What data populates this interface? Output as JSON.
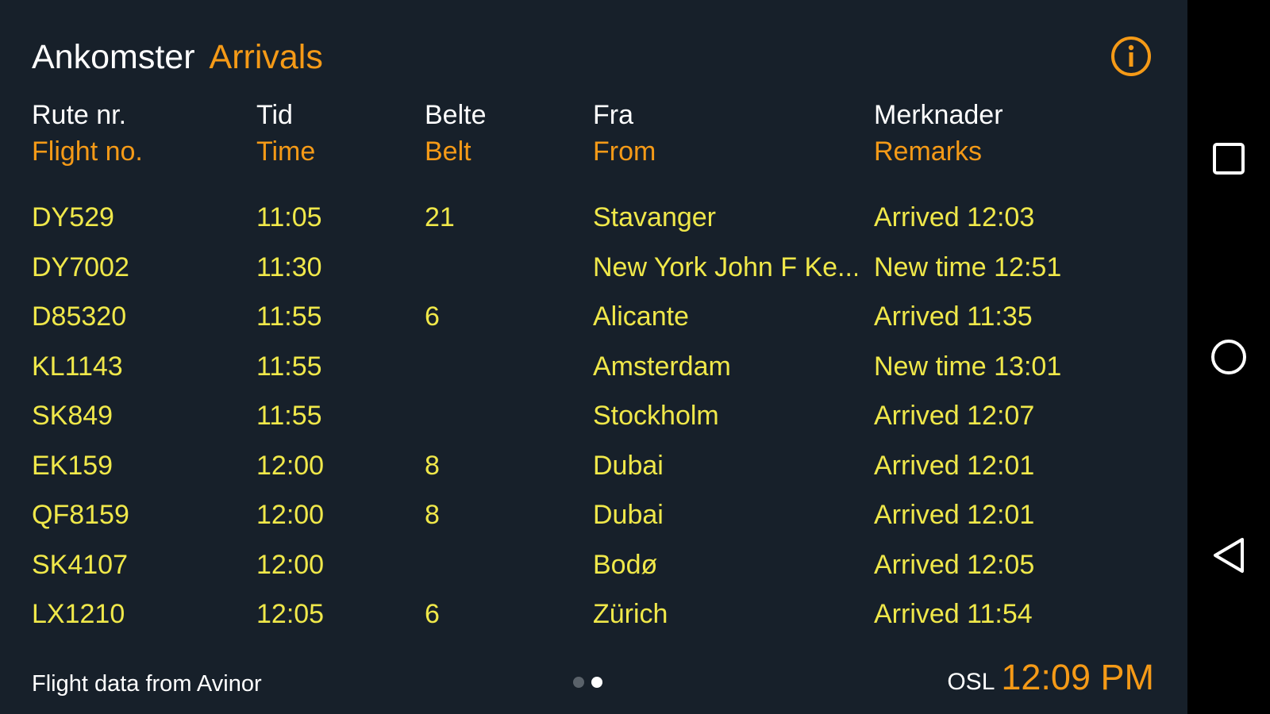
{
  "header": {
    "title_no": "Ankomster",
    "title_en": "Arrivals",
    "info_icon": "info-circle-icon"
  },
  "columns": [
    {
      "no": "Rute nr.",
      "en": "Flight no."
    },
    {
      "no": "Tid",
      "en": "Time"
    },
    {
      "no": "Belte",
      "en": "Belt"
    },
    {
      "no": "Fra",
      "en": "From"
    },
    {
      "no": "Merknader",
      "en": "Remarks"
    }
  ],
  "flights": [
    {
      "flight": "DY529",
      "time": "11:05",
      "belt": "21",
      "from": "Stavanger",
      "remarks": "Arrived 12:03"
    },
    {
      "flight": "DY7002",
      "time": "11:30",
      "belt": "",
      "from": "New York John F Ke...",
      "remarks": "New time 12:51"
    },
    {
      "flight": "D85320",
      "time": "11:55",
      "belt": "6",
      "from": "Alicante",
      "remarks": "Arrived 11:35"
    },
    {
      "flight": "KL1143",
      "time": "11:55",
      "belt": "",
      "from": "Amsterdam",
      "remarks": "New time 13:01"
    },
    {
      "flight": "SK849",
      "time": "11:55",
      "belt": "",
      "from": "Stockholm",
      "remarks": "Arrived 12:07"
    },
    {
      "flight": "EK159",
      "time": "12:00",
      "belt": "8",
      "from": "Dubai",
      "remarks": "Arrived 12:01"
    },
    {
      "flight": "QF8159",
      "time": "12:00",
      "belt": "8",
      "from": "Dubai",
      "remarks": "Arrived 12:01"
    },
    {
      "flight": "SK4107",
      "time": "12:00",
      "belt": "",
      "from": "Bodø",
      "remarks": "Arrived 12:05"
    },
    {
      "flight": "LX1210",
      "time": "12:05",
      "belt": "6",
      "from": "Zürich",
      "remarks": "Arrived 11:54"
    }
  ],
  "footer": {
    "source": "Flight data from Avinor",
    "page_count": 2,
    "active_page": 2,
    "airport_code": "OSL",
    "clock": "12:09 PM"
  },
  "navbar": {
    "buttons": [
      "recents-square-icon",
      "home-circle-icon",
      "back-triangle-icon"
    ]
  },
  "colors": {
    "background": "#17202a",
    "accent_orange": "#f59a17",
    "row_yellow": "#f0e84a",
    "navbar": "#000000"
  }
}
